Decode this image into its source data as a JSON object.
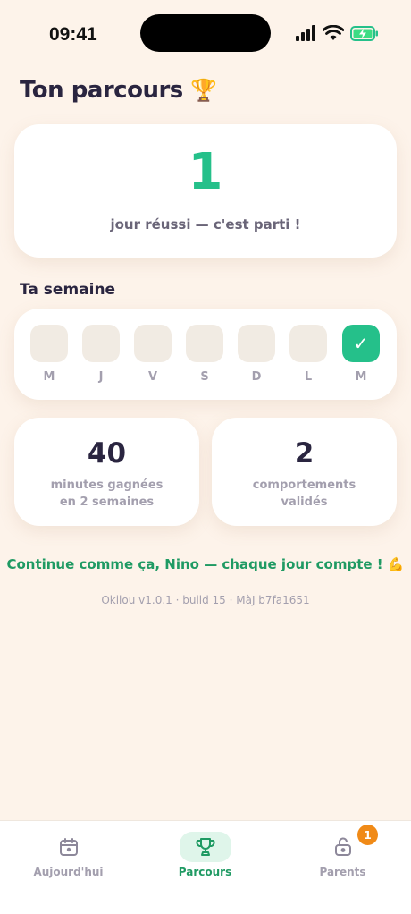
{
  "status_bar": {
    "time": "09:41"
  },
  "page": {
    "title": "Ton parcours",
    "title_emoji": "🏆"
  },
  "streak": {
    "count": "1",
    "caption": "jour réussi — c'est parti !"
  },
  "week": {
    "title": "Ta semaine",
    "days": [
      {
        "label": "M",
        "done": false
      },
      {
        "label": "J",
        "done": false
      },
      {
        "label": "V",
        "done": false
      },
      {
        "label": "S",
        "done": false
      },
      {
        "label": "D",
        "done": false
      },
      {
        "label": "L",
        "done": false
      },
      {
        "label": "M",
        "done": true,
        "mark": "✓"
      }
    ]
  },
  "stats": [
    {
      "value": "40",
      "line1": "minutes gagnées",
      "line2": "en 2 semaines"
    },
    {
      "value": "2",
      "line1": "comportements",
      "line2": "validés"
    }
  ],
  "encouragement": "Continue comme ça, Nino — chaque jour compte ! 💪",
  "version": "Okilou v1.0.1 · build 15 · MàJ b7fa1651",
  "tabs": [
    {
      "label": "Aujourd'hui",
      "icon": "calendar-icon",
      "active": false
    },
    {
      "label": "Parcours",
      "icon": "trophy-icon",
      "active": true
    },
    {
      "label": "Parents",
      "icon": "lock-icon",
      "active": false,
      "badge": "1"
    }
  ],
  "colors": {
    "accent": "#25c08a",
    "background": "#fdf3ea",
    "badge": "#f08a17"
  }
}
